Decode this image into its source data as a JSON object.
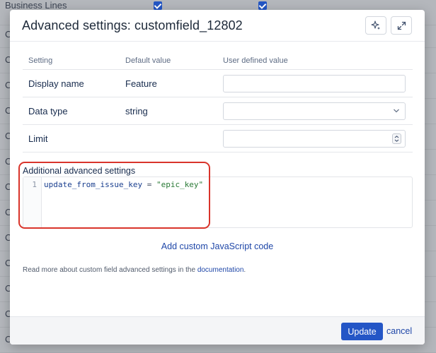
{
  "background": {
    "first_row_label": "Business Lines",
    "row_initial": "C"
  },
  "modal": {
    "title": "Advanced settings: customfield_12802",
    "header_buttons": {
      "ai_icon": "sparkle-icon",
      "expand_icon": "expand-icon"
    },
    "table": {
      "headers": [
        "Setting",
        "Default value",
        "User defined value"
      ],
      "rows": [
        {
          "setting": "Display name",
          "default": "Feature",
          "user_value": "",
          "control": "text"
        },
        {
          "setting": "Data type",
          "default": "string",
          "user_value": "",
          "control": "select"
        },
        {
          "setting": "Limit",
          "default": "",
          "user_value": "",
          "control": "number"
        }
      ]
    },
    "additional": {
      "label": "Additional advanced settings",
      "line_number": "1",
      "code_key": "update_from_issue_key",
      "code_op": " = ",
      "code_value": "\"epic_key\""
    },
    "add_js_label": "Add custom JavaScript code",
    "footnote_text": "Read more about custom field advanced settings in the ",
    "footnote_link": "documentation",
    "footnote_end": ".",
    "footer": {
      "update_label": "Update",
      "cancel_label": "cancel"
    }
  },
  "colors": {
    "accent": "#2456c6",
    "highlight": "#d9342b",
    "link": "#1f47a8"
  }
}
